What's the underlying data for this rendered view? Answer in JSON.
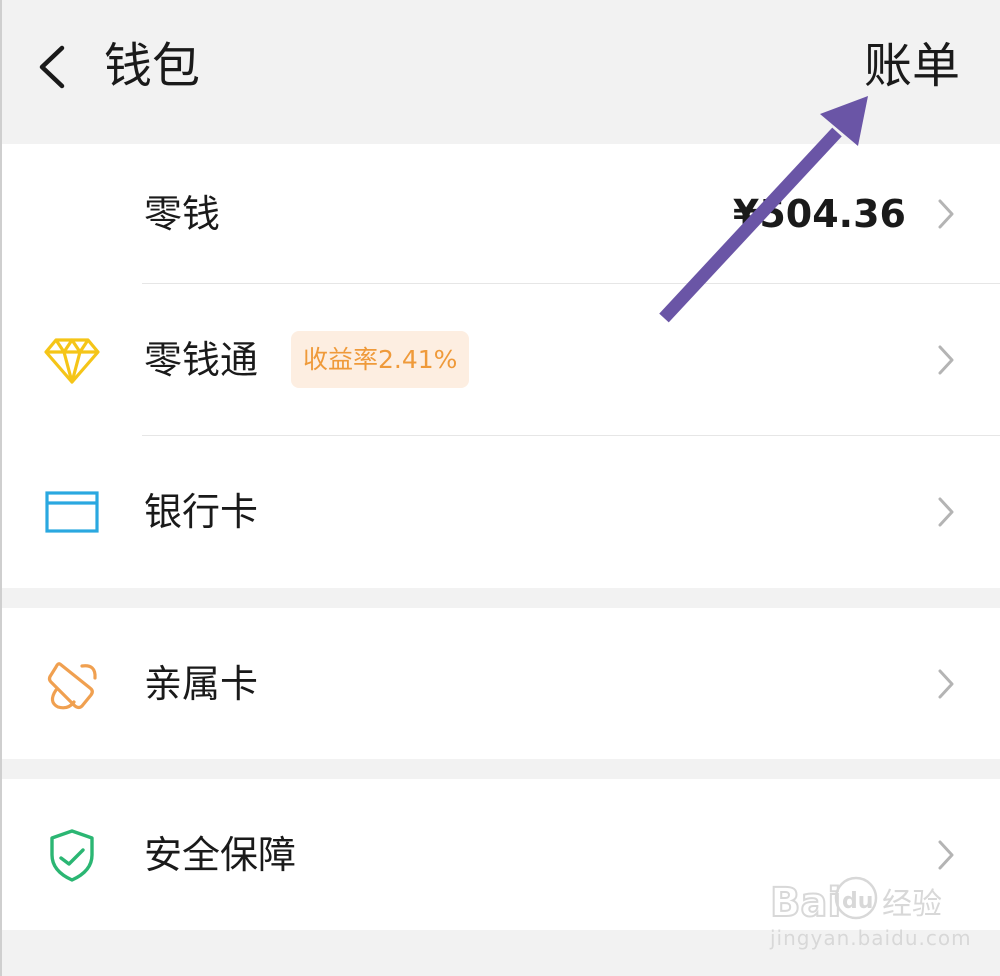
{
  "header": {
    "title": "钱包",
    "bill_label": "账单"
  },
  "rows": [
    {
      "label": "零钱",
      "value": "¥504.36"
    },
    {
      "label": "零钱通",
      "badge": "收益率2.41%"
    },
    {
      "label": "银行卡"
    },
    {
      "label": "亲属卡"
    },
    {
      "label": "安全保障"
    }
  ],
  "icons": {
    "back": "chevron-left-icon",
    "lingqiantong": "diamond-icon",
    "bank_card": "bank-card-icon",
    "family_card": "family-card-icon",
    "security": "shield-check-icon",
    "row_arrow": "chevron-right-icon"
  },
  "watermark": {
    "brand": "Baidu经验",
    "domain": "jingyan.baidu.com"
  },
  "colors": {
    "background": "#f2f2f2",
    "card": "#ffffff",
    "badge_bg": "#fdeee1",
    "badge_text": "#ef9a3a",
    "diamond": "#f5c518",
    "bank_card": "#2aa8e0",
    "family_card": "#f0a050",
    "security": "#2bb673",
    "arrow": "#6a55a6"
  }
}
